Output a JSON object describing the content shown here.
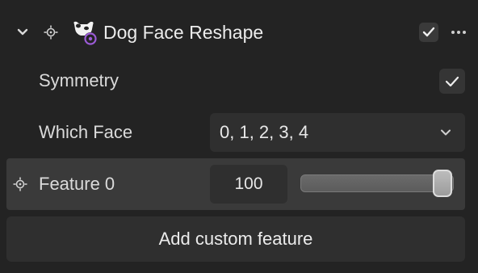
{
  "header": {
    "title": "Dog Face Reshape",
    "enabled": true,
    "icons": {
      "collapse": "chevron-down-icon",
      "target": "target-icon",
      "dog": "dog-face-icon",
      "more": "more-icon"
    }
  },
  "symmetry": {
    "label": "Symmetry",
    "checked": true
  },
  "which_face": {
    "label": "Which Face",
    "value": "0, 1, 2, 3, 4"
  },
  "feature": {
    "label": "Feature 0",
    "value": "100",
    "slider_fraction": 1.0
  },
  "add_button": {
    "label": "Add custom feature"
  },
  "colors": {
    "accent_purple": "#9b5bd6",
    "panel_bg": "#232323",
    "row_highlight": "#3a3a3a"
  }
}
